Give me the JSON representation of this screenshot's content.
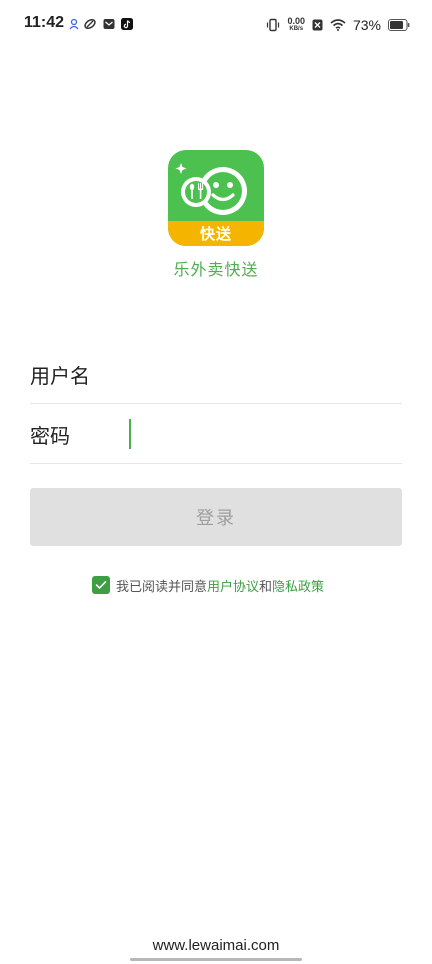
{
  "status_bar": {
    "time": "11:42",
    "net_speed_value": "0.00",
    "net_speed_unit": "KB/s",
    "battery_percent": "73%"
  },
  "logo": {
    "badge_text": "快送",
    "app_name": "乐外卖快送"
  },
  "form": {
    "username_label": "用户名",
    "username_value": "",
    "password_label": "密码",
    "password_value": ""
  },
  "login_button_label": "登录",
  "agreement": {
    "checked": true,
    "text_prefix": "我已阅读并同意",
    "user_agreement_link": "用户协议",
    "and_text": "和",
    "privacy_policy_link": "隐私政策"
  },
  "footer": {
    "website": "www.lewaimai.com"
  },
  "colors": {
    "brand_green": "#4caf50",
    "logo_green": "#4dc150",
    "logo_band_yellow": "#f5b400",
    "checkbox_green": "#3e9e43",
    "button_disabled_bg": "#e0e0e0"
  }
}
